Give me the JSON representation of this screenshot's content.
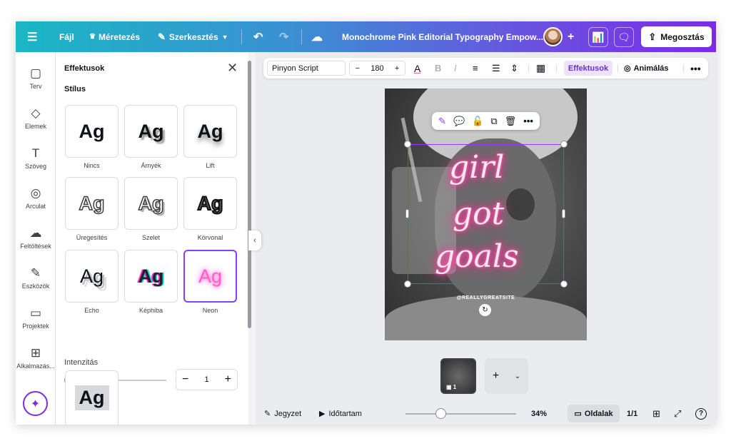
{
  "topbar": {
    "menu_icon": "hamburger-menu-icon",
    "file_label": "Fájl",
    "resize_label": "Méretezés",
    "edit_label": "Szerkesztés",
    "doc_title": "Monochrome Pink Editorial Typography Empow...",
    "share_label": "Megosztás"
  },
  "rail": {
    "items": [
      {
        "icon": "▢",
        "label": "Terv"
      },
      {
        "icon": "◇",
        "label": "Elemek"
      },
      {
        "icon": "T",
        "label": "Szöveg"
      },
      {
        "icon": "◎",
        "label": "Arculat"
      },
      {
        "icon": "☁",
        "label": "Feltöltések"
      },
      {
        "icon": "✎",
        "label": "Eszközök"
      },
      {
        "icon": "▭",
        "label": "Projektek"
      },
      {
        "icon": "⊞",
        "label": "Alkalmazás..."
      }
    ]
  },
  "panel": {
    "title": "Effektusok",
    "style_heading": "Stílus",
    "sample_text": "Ag",
    "styles": [
      {
        "label": "Nincs"
      },
      {
        "label": "Árnyék"
      },
      {
        "label": "Lift"
      },
      {
        "label": "Üregesítés"
      },
      {
        "label": "Szelet"
      },
      {
        "label": "Körvonal"
      },
      {
        "label": "Echo"
      },
      {
        "label": "Képhiba"
      },
      {
        "label": "Neon"
      }
    ],
    "intensity_label": "Intenzitás",
    "intensity_value": "1",
    "intensity_level": 0.0
  },
  "toolbar": {
    "font_name": "Pinyon Script",
    "font_size": "180",
    "effects_label": "Effektusok",
    "animate_label": "Animálás"
  },
  "canvas": {
    "line1": "girl",
    "line2": "got",
    "line3": "goals",
    "handle": "@REALLYGREATSITE"
  },
  "pages": {
    "thumb_badge": "1"
  },
  "bottombar": {
    "notes_label": "Jegyzet",
    "duration_label": "Időtartam",
    "zoom": "34%",
    "pages_label": "Oldalak",
    "page_count": "1/1"
  },
  "colors": {
    "accent": "#8b3dff",
    "neon_glow": "#ff2f9a"
  }
}
